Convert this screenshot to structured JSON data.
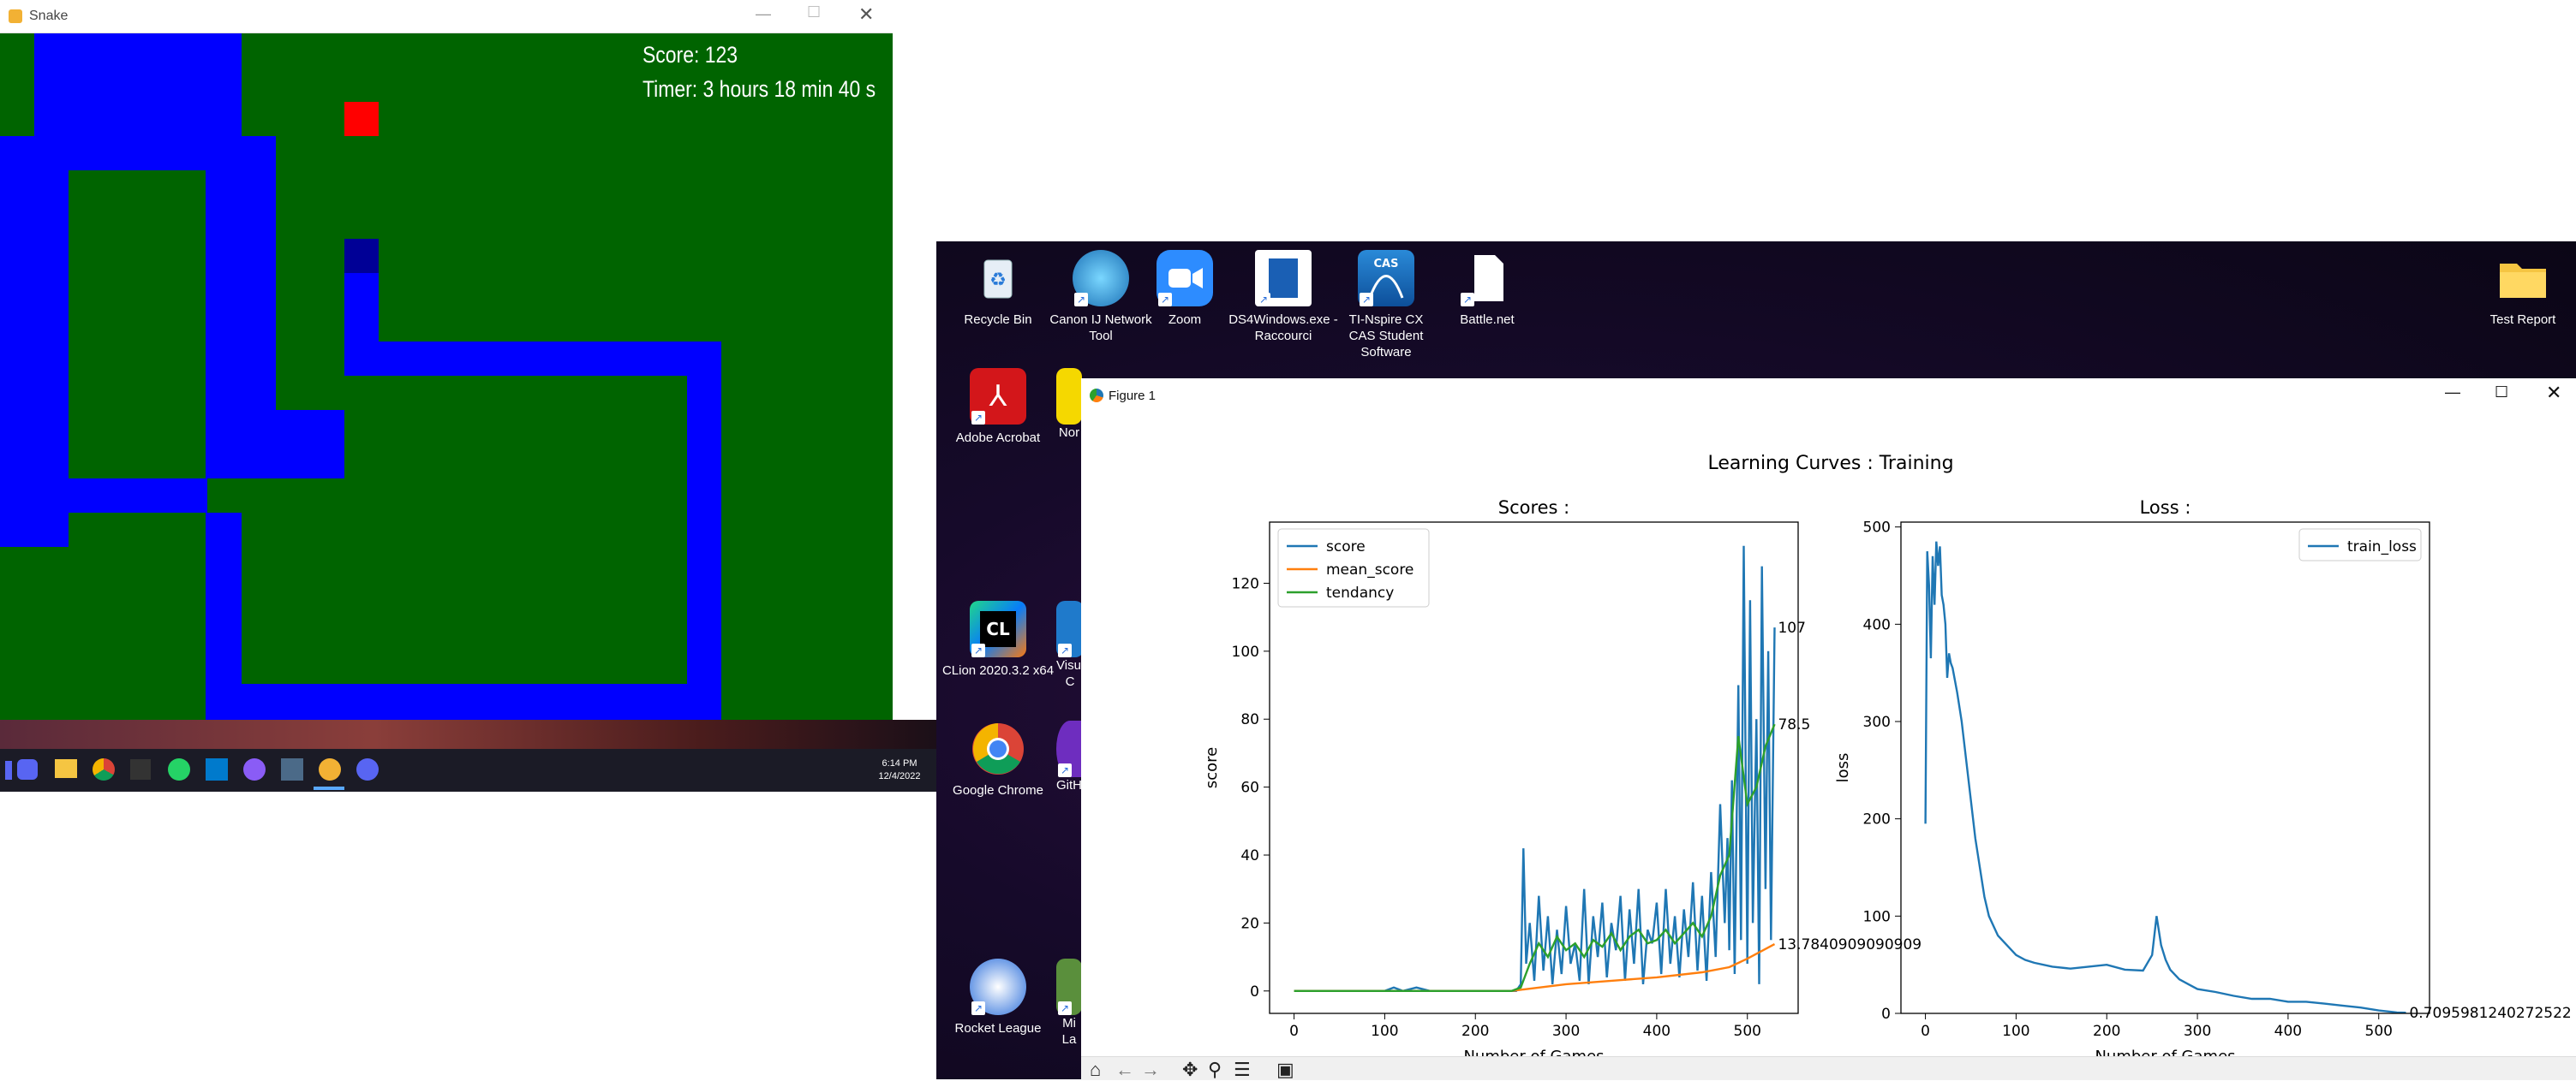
{
  "snake_window": {
    "title": "Snake",
    "score_label": "Score: 123",
    "timer_label": "Timer: 3 hours 18 min 40 s",
    "colors": {
      "background": "#006400",
      "snake": "#0000ff",
      "head": "#000096",
      "food": "#ff0000"
    }
  },
  "taskbar": {
    "time": "6:14 PM",
    "date": "12/4/2022",
    "icons": [
      "discord-icon",
      "file-explorer-icon",
      "chrome-icon",
      "graph-icon",
      "whatsapp-icon",
      "vscode-icon",
      "github-icon",
      "python-game-icon",
      "snake-app-icon",
      "discord-icon-2"
    ]
  },
  "desktop": {
    "icons": [
      {
        "label": "Recycle Bin",
        "icon": "recycle-bin-icon"
      },
      {
        "label": "Canon IJ Network Tool",
        "icon": "globe-icon"
      },
      {
        "label": "Zoom",
        "icon": "zoom-icon"
      },
      {
        "label": "DS4Windows.exe - Raccourci",
        "icon": "ds4windows-icon"
      },
      {
        "label": "TI-Nspire CX CAS Student Software",
        "icon": "ti-nspire-icon"
      },
      {
        "label": "Battle.net",
        "icon": "file-icon"
      },
      {
        "label": "Test Report",
        "icon": "folder-icon"
      },
      {
        "label": "Adobe Acrobat",
        "icon": "acrobat-icon"
      },
      {
        "label": "Nor",
        "icon": "norton-icon"
      },
      {
        "label": "CLion 2020.3.2 x64",
        "icon": "clion-icon"
      },
      {
        "label": "Visua C",
        "icon": "vs-icon"
      },
      {
        "label": "Google Chrome",
        "icon": "chrome-icon"
      },
      {
        "label": "GitHub",
        "icon": "github-desktop-icon"
      },
      {
        "label": "Rocket League",
        "icon": "rocket-league-icon"
      },
      {
        "label": "Mi La",
        "icon": "minecraft-icon"
      }
    ]
  },
  "figure_window": {
    "title": "Figure 1",
    "suptitle": "Learning Curves : Training",
    "toolbar": [
      "home-icon",
      "back-icon",
      "forward-icon",
      "pan-icon",
      "zoom-icon",
      "configure-icon",
      "save-icon"
    ]
  },
  "chart_data": [
    {
      "type": "line",
      "title": "Scores :",
      "xlabel": "Number of Games",
      "ylabel": "score",
      "xlim": [
        -27,
        556
      ],
      "ylim": [
        -6.6,
        138
      ],
      "xticks": [
        0,
        100,
        200,
        300,
        400,
        500
      ],
      "yticks": [
        0,
        20,
        40,
        60,
        80,
        100,
        120
      ],
      "legend_position": "top-left",
      "grid": false,
      "series": [
        {
          "name": "score",
          "color": "#1f77b4",
          "x": [
            0,
            100,
            110,
            120,
            135,
            150,
            200,
            240,
            245,
            250,
            253,
            256,
            260,
            265,
            270,
            275,
            280,
            285,
            290,
            295,
            300,
            305,
            310,
            315,
            320,
            325,
            330,
            335,
            340,
            345,
            350,
            355,
            360,
            365,
            370,
            375,
            380,
            385,
            390,
            395,
            400,
            405,
            410,
            415,
            420,
            425,
            430,
            435,
            440,
            445,
            450,
            455,
            460,
            465,
            470,
            475,
            478,
            480,
            483,
            486,
            490,
            493,
            496,
            500,
            503,
            506,
            510,
            513,
            516,
            520,
            523,
            526,
            530
          ],
          "y": [
            0,
            0,
            1,
            0,
            1,
            0,
            0,
            0,
            0,
            2,
            42,
            8,
            20,
            3,
            28,
            6,
            22,
            2,
            18,
            5,
            25,
            8,
            14,
            3,
            30,
            2,
            22,
            10,
            26,
            4,
            20,
            12,
            28,
            3,
            24,
            8,
            30,
            2,
            18,
            14,
            26,
            5,
            30,
            8,
            22,
            4,
            24,
            10,
            32,
            6,
            28,
            3,
            35,
            10,
            55,
            20,
            45,
            12,
            62,
            5,
            90,
            15,
            131,
            8,
            115,
            20,
            80,
            2,
            125,
            30,
            100,
            15,
            107
          ]
        },
        {
          "name": "mean_score",
          "color": "#ff7f0e",
          "x": [
            0,
            240,
            255,
            300,
            350,
            400,
            450,
            480,
            500,
            530
          ],
          "y": [
            0,
            0,
            0.5,
            2,
            3,
            4,
            5.5,
            7,
            9.5,
            13.7840909090909
          ]
        },
        {
          "name": "tendancy",
          "color": "#2ca02c",
          "x": [
            0,
            240,
            250,
            260,
            270,
            280,
            290,
            300,
            310,
            320,
            330,
            340,
            350,
            360,
            370,
            380,
            390,
            400,
            410,
            420,
            430,
            440,
            450,
            460,
            470,
            480,
            490,
            500,
            510,
            520,
            530
          ],
          "y": [
            0,
            0,
            1,
            8,
            14,
            10,
            16,
            12,
            14,
            10,
            15,
            13,
            17,
            12,
            16,
            18,
            14,
            15,
            18,
            14,
            17,
            20,
            16,
            22,
            34,
            40,
            75,
            55,
            60,
            72,
            78.5
          ]
        }
      ],
      "annotations": [
        "107",
        "78.5",
        "13.7840909090909"
      ]
    },
    {
      "type": "line",
      "title": "Loss :",
      "xlabel": "Number of Games",
      "ylabel": "loss",
      "xlim": [
        -27,
        556
      ],
      "ylim": [
        0,
        505
      ],
      "xticks": [
        0,
        100,
        200,
        300,
        400,
        500
      ],
      "yticks": [
        0,
        100,
        200,
        300,
        400,
        500
      ],
      "legend_position": "top-right",
      "grid": false,
      "series": [
        {
          "name": "train_loss",
          "color": "#1f77b4",
          "x": [
            0,
            2,
            4,
            6,
            8,
            10,
            12,
            14,
            16,
            18,
            20,
            22,
            24,
            26,
            28,
            30,
            35,
            40,
            45,
            50,
            55,
            60,
            65,
            70,
            80,
            90,
            100,
            110,
            120,
            140,
            160,
            180,
            200,
            220,
            240,
            250,
            255,
            260,
            265,
            270,
            280,
            290,
            300,
            320,
            340,
            360,
            380,
            400,
            420,
            440,
            460,
            480,
            500,
            520,
            530
          ],
          "y": [
            195,
            475,
            440,
            365,
            470,
            420,
            485,
            460,
            480,
            430,
            420,
            400,
            345,
            370,
            360,
            355,
            330,
            300,
            260,
            220,
            180,
            150,
            120,
            100,
            80,
            70,
            60,
            55,
            52,
            48,
            46,
            48,
            50,
            45,
            44,
            60,
            100,
            70,
            55,
            45,
            35,
            30,
            25,
            22,
            18,
            15,
            15,
            12,
            12,
            10,
            8,
            6,
            3,
            1,
            0.7095981240272522
          ]
        }
      ],
      "annotations": [
        "0.7095981240272522"
      ]
    }
  ]
}
